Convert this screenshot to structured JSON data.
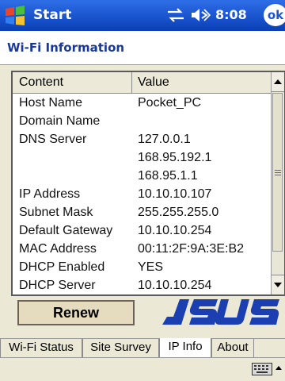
{
  "taskbar": {
    "start_label": "Start",
    "time": "8:08",
    "ok_label": "ok"
  },
  "window": {
    "title": "Wi-Fi Information"
  },
  "table": {
    "headers": [
      "Content",
      "Value"
    ],
    "rows": [
      {
        "content": "Host Name",
        "value": "Pocket_PC"
      },
      {
        "content": "Domain Name",
        "value": ""
      },
      {
        "content": "DNS Server",
        "value": "127.0.0.1"
      },
      {
        "content": "",
        "value": "168.95.192.1"
      },
      {
        "content": "",
        "value": "168.95.1.1"
      },
      {
        "content": "IP Address",
        "value": "10.10.10.107"
      },
      {
        "content": "Subnet Mask",
        "value": "255.255.255.0"
      },
      {
        "content": "Default Gateway",
        "value": "10.10.10.254"
      },
      {
        "content": "MAC Address",
        "value": "00:11:2F:9A:3E:B2"
      },
      {
        "content": "DHCP Enabled",
        "value": "YES"
      },
      {
        "content": "DHCP Server",
        "value": "10.10.10.254"
      }
    ]
  },
  "actions": {
    "renew_label": "Renew"
  },
  "brand": {
    "logo_text": "ASUS",
    "color": "#1b3fb0"
  },
  "tabs": [
    {
      "label": "Wi-Fi Status",
      "active": false
    },
    {
      "label": "Site Survey",
      "active": false
    },
    {
      "label": "IP Info",
      "active": true
    },
    {
      "label": "About",
      "active": false
    }
  ],
  "icons": {
    "start": "windows-flag-icon",
    "connectivity": "connectivity-icon",
    "volume": "volume-icon",
    "keyboard": "keyboard-icon"
  }
}
